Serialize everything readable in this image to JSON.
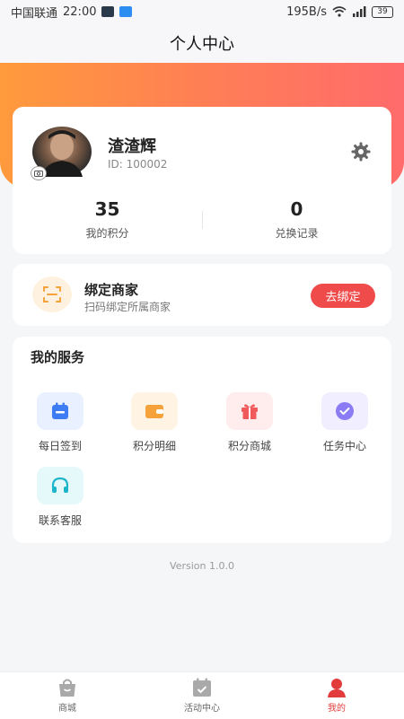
{
  "status_bar": {
    "carrier": "中国联通",
    "time": "22:00",
    "speed": "195B/s",
    "battery": "39"
  },
  "header": {
    "title": "个人中心"
  },
  "profile": {
    "name": "渣渣辉",
    "id_text": "ID: 100002",
    "stats": [
      {
        "value": "35",
        "label": "我的积分"
      },
      {
        "value": "0",
        "label": "兑换记录"
      }
    ]
  },
  "bind_merchant": {
    "title": "绑定商家",
    "subtitle": "扫码绑定所属商家",
    "button": "去绑定"
  },
  "services": {
    "title": "我的服务",
    "items": [
      {
        "label": "每日签到",
        "icon": "calendar-icon",
        "color": "#3d7cf2",
        "bg": "#e9f0ff"
      },
      {
        "label": "积分明细",
        "icon": "wallet-icon",
        "color": "#f5a23a",
        "bg": "#fff3e3"
      },
      {
        "label": "积分商城",
        "icon": "gift-icon",
        "color": "#f15a5a",
        "bg": "#ffecec"
      },
      {
        "label": "任务中心",
        "icon": "check-circle-icon",
        "color": "#8b7cf6",
        "bg": "#f1eeff"
      },
      {
        "label": "联系客服",
        "icon": "headset-icon",
        "color": "#1cb5c9",
        "bg": "#e5f8fa"
      }
    ]
  },
  "version": "Version 1.0.0",
  "bottom_nav": [
    {
      "label": "商城",
      "icon": "shopping-bag-icon"
    },
    {
      "label": "活动中心",
      "icon": "calendar-check-icon"
    },
    {
      "label": "我的",
      "icon": "person-icon",
      "active": true
    }
  ],
  "colors": {
    "accent": "#ef4b4b",
    "gradient_start": "#ff9a3c",
    "gradient_end": "#ff6b6b"
  }
}
